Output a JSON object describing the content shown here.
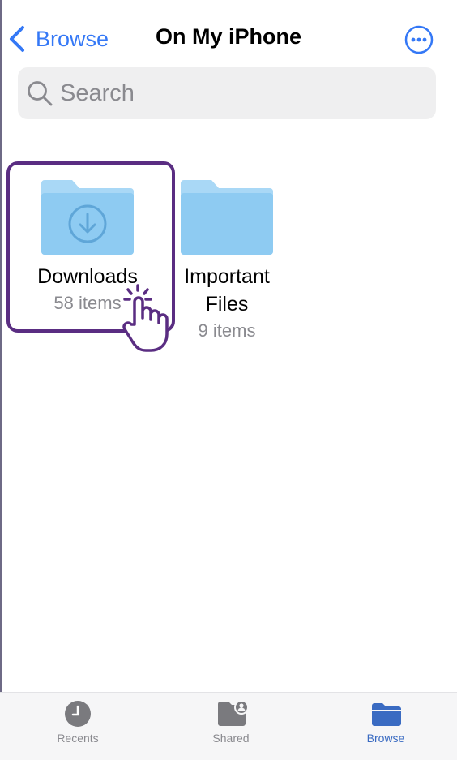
{
  "nav": {
    "back_label": "Browse",
    "title": "On My iPhone",
    "more_icon": "ellipsis-circle-icon"
  },
  "search": {
    "placeholder": "Search"
  },
  "folders": [
    {
      "name_line1": "Downloads",
      "name_line2": "",
      "count": "58 items",
      "icon": "download-folder-icon"
    },
    {
      "name_line1": "Important",
      "name_line2": "Files",
      "count": "9 items",
      "icon": "folder-icon"
    }
  ],
  "tabbar": {
    "tabs": [
      {
        "label": "Recents",
        "icon": "clock-icon",
        "active": false
      },
      {
        "label": "Shared",
        "icon": "shared-folder-icon",
        "active": false
      },
      {
        "label": "Browse",
        "icon": "folder-icon",
        "active": true
      }
    ]
  },
  "colors": {
    "accent": "#3478f6",
    "folder": "#8ecbf2",
    "highlight": "#5a2d82",
    "browse_active": "#3a6bc2"
  }
}
